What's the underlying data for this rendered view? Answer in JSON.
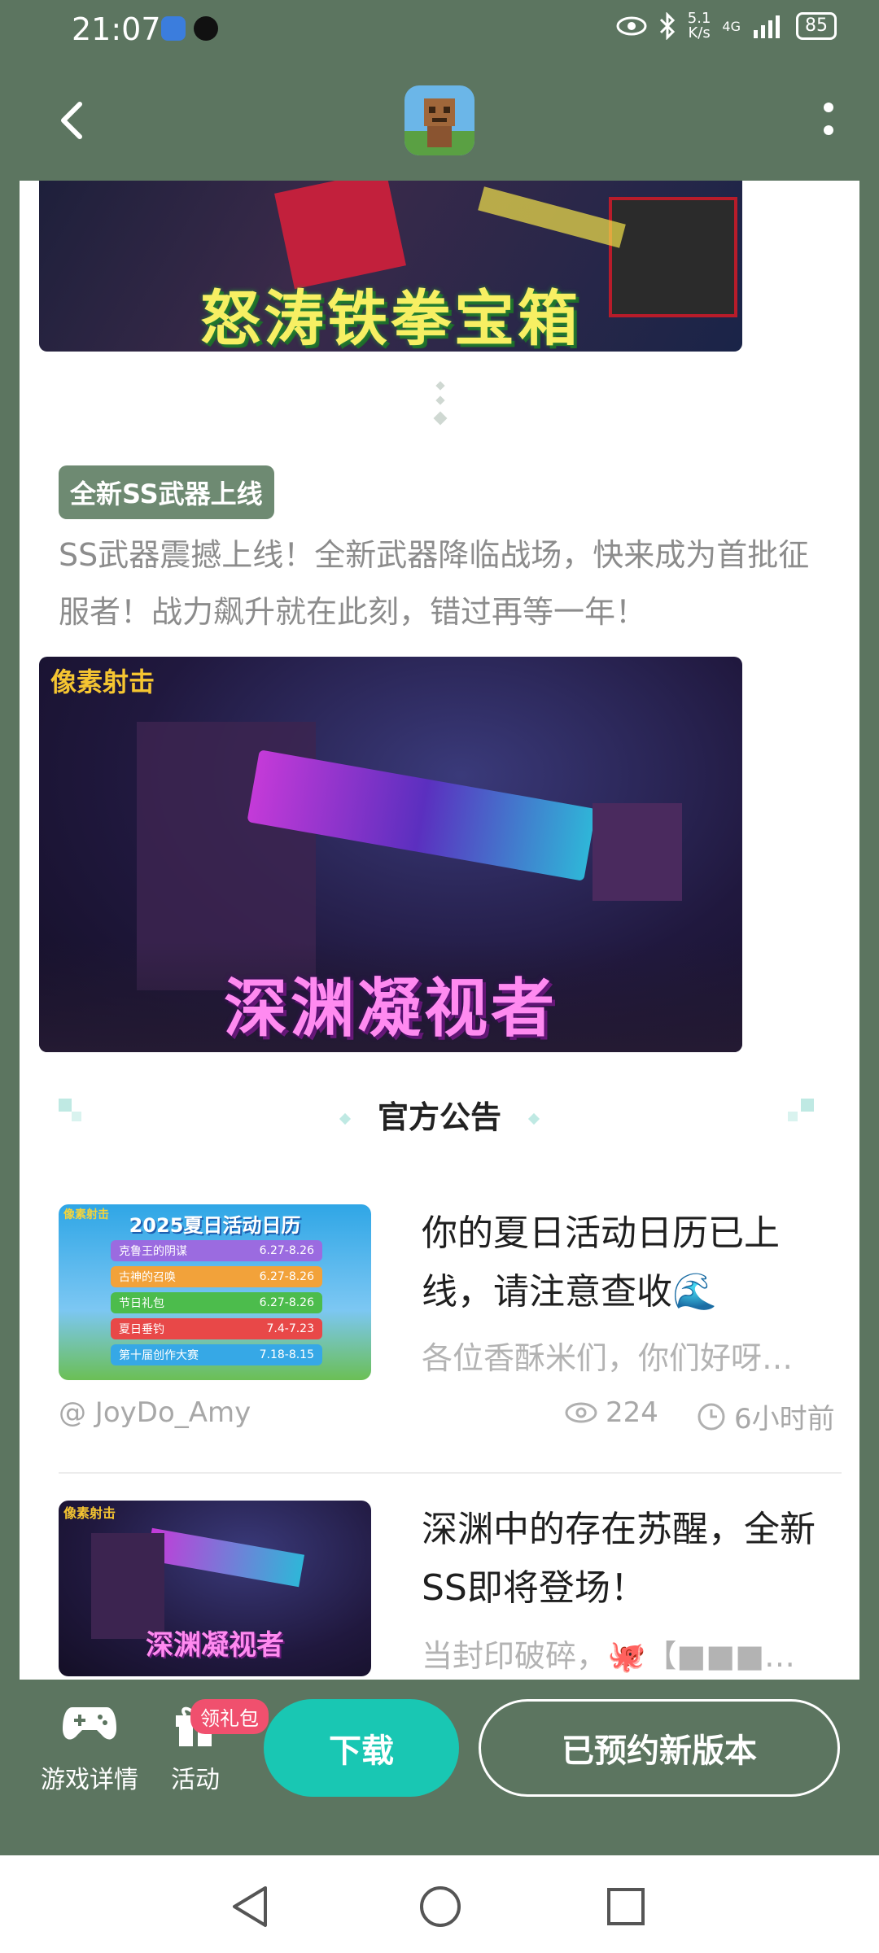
{
  "status_bar": {
    "time": "21:07",
    "network_speed": "5.1\nK/s",
    "signal": "4G",
    "battery": "85"
  },
  "header": {
    "back_icon": "chevron-left-icon",
    "app_icon": "game-app-icon",
    "more_icon": "more-vertical-icon"
  },
  "banners": {
    "top_caption": "怒涛铁拳宝箱",
    "weapon_logo": "像素射击",
    "weapon_caption": "深渊凝视者"
  },
  "section": {
    "tag": "全新SS武器上线",
    "description": "SS武器震撼上线！全新武器降临战场，快来成为首批征服者！战力飙升就在此刻，错过再等一年！"
  },
  "notices": {
    "title": "官方公告",
    "articles": [
      {
        "title": "你的夏日活动日历已上线，请注意查收🌊",
        "summary": "各位香酥米们，你们好呀…",
        "author": "@ JoyDo_Amy",
        "views": "224",
        "time": "6小时前",
        "thumb": {
          "heading": "2025夏日活动日历",
          "rows": [
            {
              "name": "克鲁王的阴谋",
              "date": "6.27-8.26"
            },
            {
              "name": "古神的召唤",
              "date": "6.27-8.26"
            },
            {
              "name": "节日礼包",
              "date": "6.27-8.26"
            },
            {
              "name": "夏日垂钓",
              "date": "7.4-7.23"
            },
            {
              "name": "第十届创作大赛",
              "date": "7.18-8.15"
            }
          ],
          "logo": "像素射击"
        }
      },
      {
        "title": "深渊中的存在苏醒，全新SS即将登场！",
        "summary": "当封印破碎，🐙【■■■…",
        "thumb": {
          "logo": "像素射击",
          "caption": "深渊凝视者"
        }
      }
    ]
  },
  "bottom_bar": {
    "game_details": "游戏详情",
    "activity": "活动",
    "gift_badge": "领礼包",
    "download": "下载",
    "reserve": "已预约新版本"
  },
  "colors": {
    "header_bg": "#5c7560",
    "accent": "#19c7b3",
    "tag_bg": "#6e8a72",
    "badge": "#f0506e"
  }
}
